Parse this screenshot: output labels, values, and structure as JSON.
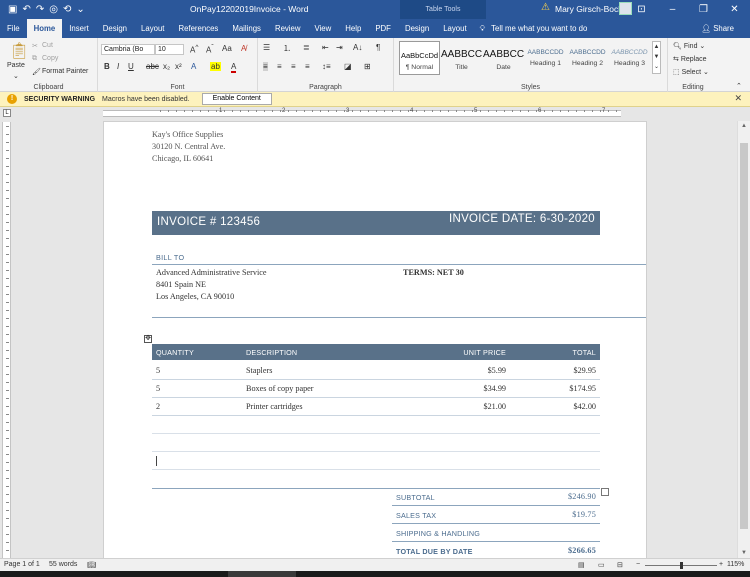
{
  "window": {
    "title": "OnPay12202019Invoice - Word",
    "context_tab_group": "Table Tools",
    "user": "Mary Girsch-Bock",
    "accent": "#2b579a"
  },
  "tabs": [
    "File",
    "Home",
    "Insert",
    "Design",
    "Layout",
    "References",
    "Mailings",
    "Review",
    "View",
    "Help",
    "PDF"
  ],
  "context_tabs": [
    "Design",
    "Layout"
  ],
  "tell_me": "Tell me what you want to do",
  "share": "Share",
  "ribbon": {
    "clipboard": {
      "paste": "Paste",
      "cut": "Cut",
      "copy": "Copy",
      "format_painter": "Format Painter",
      "label": "Clipboard"
    },
    "font": {
      "name": "Cambria (Bo",
      "size": "10",
      "label": "Font"
    },
    "paragraph": {
      "label": "Paragraph"
    },
    "styles": {
      "label": "Styles",
      "items": [
        {
          "sample": "AaBbCcDd",
          "name": "¶ Normal"
        },
        {
          "sample": "AABBCC",
          "name": "Title"
        },
        {
          "sample": "AABBCC",
          "name": "Date"
        },
        {
          "sample": "AABBCCDD",
          "name": "Heading 1"
        },
        {
          "sample": "AABBCCDD",
          "name": "Heading 2"
        },
        {
          "sample": "AABBCCDD",
          "name": "Heading 3"
        }
      ]
    },
    "editing": {
      "find": "Find",
      "replace": "Replace",
      "select": "Select",
      "label": "Editing"
    }
  },
  "message_bar": {
    "title": "SECURITY WARNING",
    "text": "Macros have been disabled.",
    "button": "Enable Content"
  },
  "ruler": {
    "numbers": [
      "1",
      "2",
      "3",
      "4",
      "5",
      "6",
      "7"
    ]
  },
  "document": {
    "sender": [
      "Kay's Office Supplies",
      "30120 N. Central Ave.",
      "Chicago, IL 60641"
    ],
    "invoice_number": "INVOICE # 123456",
    "invoice_date": "INVOICE DATE: 6-30-2020",
    "bill_to_label": "BILL TO",
    "bill_to": [
      "Advanced Administrative Service",
      "8401 Spain NE",
      "Los Angeles, CA 90010"
    ],
    "terms": "TERMS: NET 30",
    "table_headers": [
      "QUANTITY",
      "DESCRIPTION",
      "UNIT PRICE",
      "TOTAL"
    ],
    "rows": [
      {
        "qty": "5",
        "desc": "Staplers",
        "price": "$5.99",
        "total": "$29.95"
      },
      {
        "qty": "5",
        "desc": "Boxes of copy paper",
        "price": "$34.99",
        "total": "$174.95"
      },
      {
        "qty": "2",
        "desc": "Printer cartridges",
        "price": "$21.00",
        "total": "$42.00"
      }
    ],
    "summary": [
      {
        "label": "SUBTOTAL",
        "value": "$246.90"
      },
      {
        "label": "SALES TAX",
        "value": "$19.75"
      },
      {
        "label": "SHIPPING & HANDLING",
        "value": ""
      },
      {
        "label": "TOTAL DUE BY DATE",
        "value": "$266.65"
      }
    ],
    "header_color": "#597189"
  },
  "status": {
    "page": "Page 1 of 1",
    "words": "55 words",
    "zoom": "115%"
  }
}
